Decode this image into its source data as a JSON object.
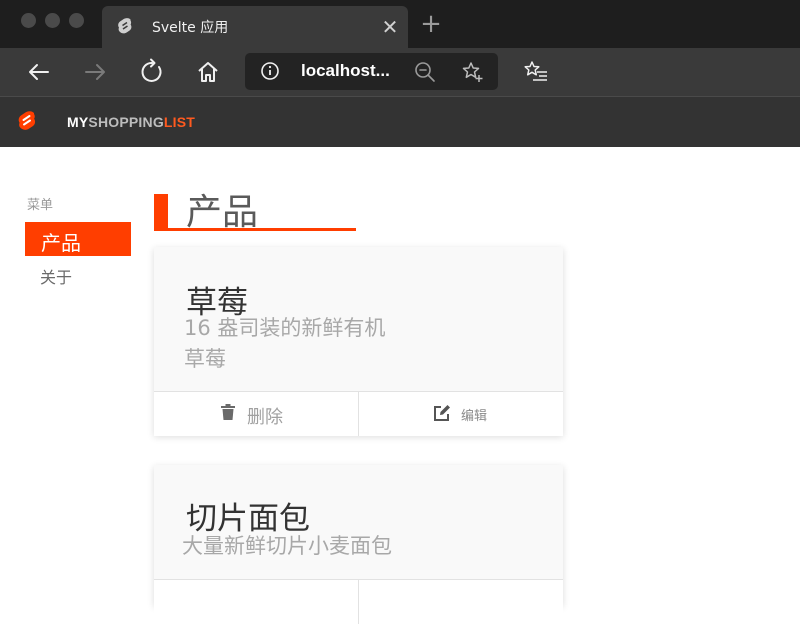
{
  "browser": {
    "tab_title": "Svelte 应用",
    "tab_close": "✕",
    "new_tab": "+",
    "address": "localhost..."
  },
  "app": {
    "brand_my": "MY",
    "brand_shopping": "SHOPPING",
    "brand_list": "LIST",
    "accent_color": "#ff3e00"
  },
  "sidebar": {
    "heading": "菜单",
    "items": [
      {
        "label": "产品",
        "active": true
      },
      {
        "label": "关于",
        "active": false
      }
    ]
  },
  "main": {
    "title": "产品",
    "products": [
      {
        "name": "草莓",
        "description_line1": "16 盎司装的新鲜有机",
        "description_line2": "草莓",
        "delete_label": "删除",
        "edit_label": "编辑"
      },
      {
        "name": "切片面包",
        "description_line1": "大量新鲜切片小麦面包"
      }
    ]
  },
  "icons": {
    "tab": "svelte-logo-icon",
    "back": "arrow-left-icon",
    "forward": "arrow-right-icon",
    "refresh": "refresh-icon",
    "home": "home-icon",
    "info": "info-icon",
    "zoom": "zoom-out-icon",
    "favorite": "star-add-icon",
    "favorites": "favorites-list-icon",
    "delete": "trash-icon",
    "edit": "edit-icon"
  }
}
